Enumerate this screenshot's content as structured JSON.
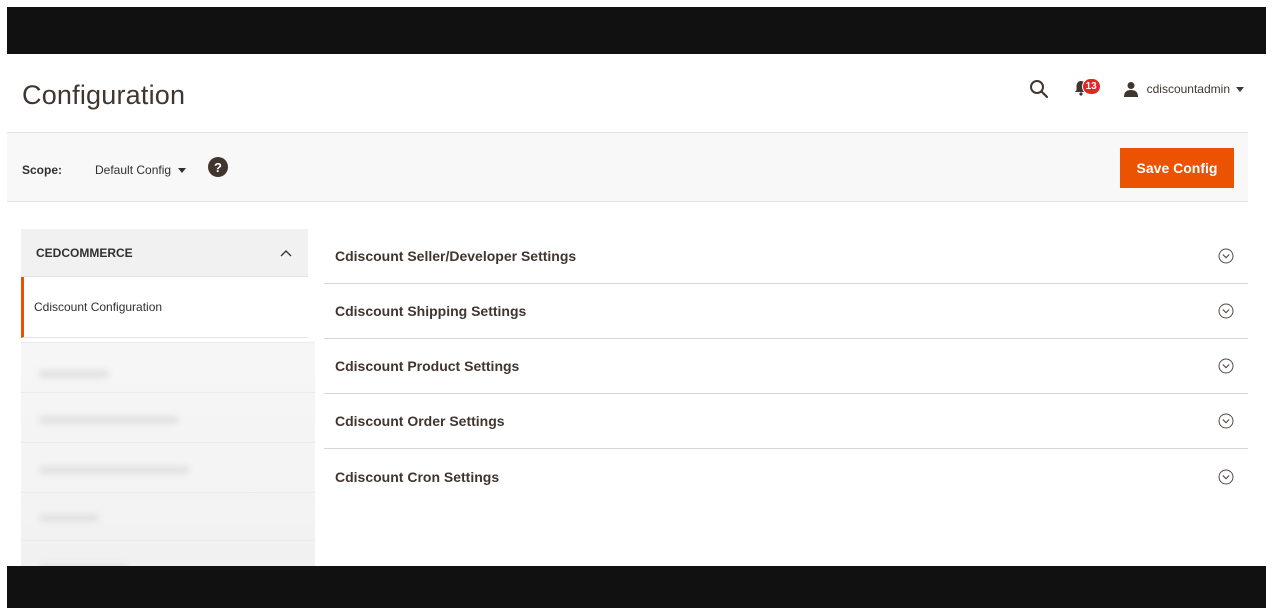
{
  "page": {
    "title": "Configuration"
  },
  "header": {
    "notifications_count": "13",
    "username": "cdiscountadmin"
  },
  "scope": {
    "label": "Scope:",
    "value": "Default Config",
    "help": "?"
  },
  "actions": {
    "save_label": "Save Config"
  },
  "sidebar": {
    "group_title": "CEDCOMMERCE",
    "active_item": "Cdiscount Configuration"
  },
  "sections": [
    {
      "title": "Cdiscount Seller/Developer Settings"
    },
    {
      "title": "Cdiscount Shipping Settings"
    },
    {
      "title": "Cdiscount Product Settings"
    },
    {
      "title": "Cdiscount Order Settings"
    },
    {
      "title": "Cdiscount Cron Settings"
    }
  ],
  "colors": {
    "accent": "#eb5202",
    "badge": "#e22626",
    "bars": "#111111"
  }
}
